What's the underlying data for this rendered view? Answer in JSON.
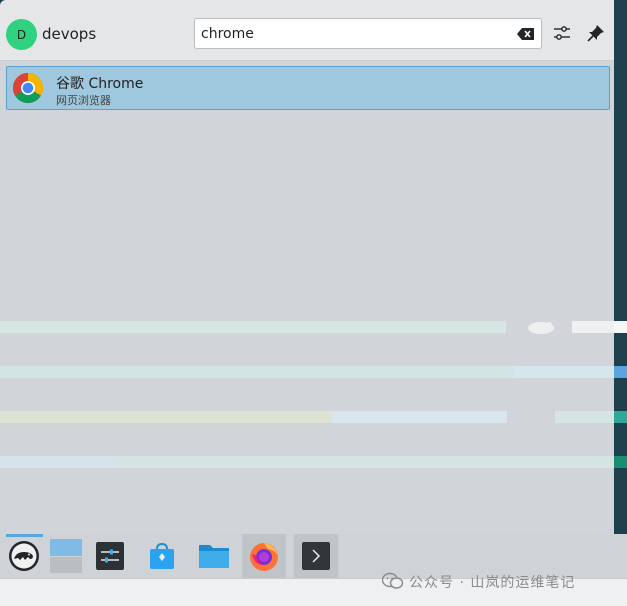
{
  "header": {
    "avatar_letter": "D",
    "user_name": "devops"
  },
  "search": {
    "value": "chrome"
  },
  "results": [
    {
      "title": "谷歌 Chrome",
      "subtitle": "网页浏览器"
    }
  ],
  "taskbar": {
    "items": [
      "opensuse-menu-icon",
      "desktop-pager",
      "system-settings-icon",
      "discover-store-icon",
      "file-manager-icon",
      "firefox-icon",
      "terminal-icon"
    ]
  },
  "watermark": {
    "text": "公众号 · 山岚的运维笔记"
  },
  "colors": {
    "accent": "#5aa5dd",
    "selection": "#9fc7de",
    "avatar": "#2fd27e"
  }
}
